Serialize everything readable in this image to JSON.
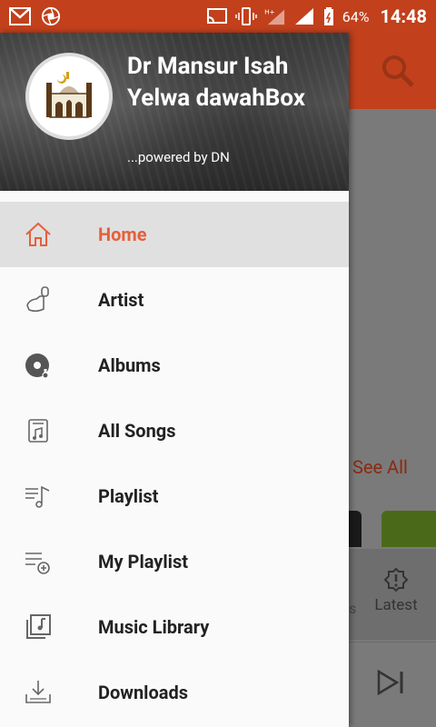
{
  "status_bar": {
    "battery": "64%",
    "time": "14:48",
    "network_label": "H+"
  },
  "background": {
    "see_all": "See All",
    "tab_latest": "Latest",
    "tab_partial": "s"
  },
  "drawer": {
    "title": "Dr Mansur Isah Yelwa dawahBox",
    "subtitle": "...powered by DN",
    "items": [
      {
        "label": "Home",
        "icon": "home-icon",
        "active": true
      },
      {
        "label": "Artist",
        "icon": "artist-icon",
        "active": false
      },
      {
        "label": "Albums",
        "icon": "album-icon",
        "active": false
      },
      {
        "label": "All Songs",
        "icon": "songs-icon",
        "active": false
      },
      {
        "label": "Playlist",
        "icon": "playlist-icon",
        "active": false
      },
      {
        "label": "My Playlist",
        "icon": "my-playlist-icon",
        "active": false
      },
      {
        "label": "Music Library",
        "icon": "library-icon",
        "active": false
      },
      {
        "label": "Downloads",
        "icon": "download-icon",
        "active": false
      }
    ]
  },
  "colors": {
    "primary": "#c2401c",
    "accent": "#e5603a"
  }
}
